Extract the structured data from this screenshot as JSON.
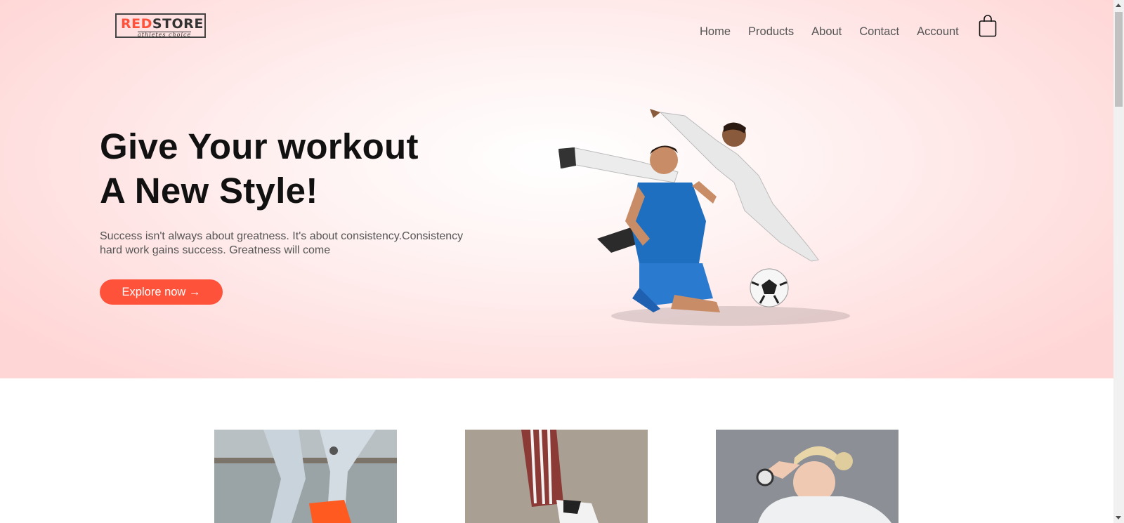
{
  "logo": {
    "part1": "RED",
    "part2": "STORE",
    "tagline": "athletes choice"
  },
  "nav": {
    "items": [
      "Home",
      "Products",
      "About",
      "Contact",
      "Account"
    ]
  },
  "cart": {
    "icon": "shopping-bag-icon"
  },
  "hero": {
    "title_line1": "Give Your workout",
    "title_line2": "A New Style!",
    "text_line1": "Success isn't always about greatness. It's about consistency.Consistency",
    "text_line2": "hard work gains success. Greatness will come",
    "button_label": "Explore now →"
  },
  "colors": {
    "accent": "#ff523b",
    "hero_bg": "#ffd6d6",
    "text": "#555555",
    "heading": "#111111"
  }
}
